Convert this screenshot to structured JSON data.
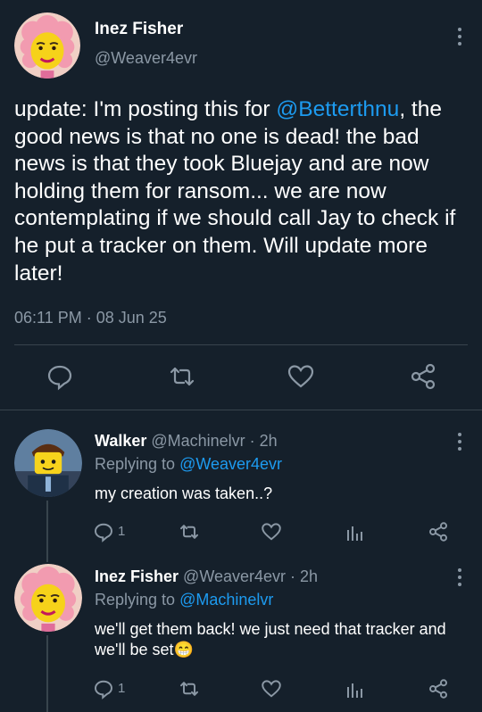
{
  "main_tweet": {
    "author_name": "Inez Fisher",
    "handle": "@Weaver4evr",
    "text_before": "update: I'm posting this for ",
    "mention": "@Betterthnu",
    "text_after": ", the good news is that no one is dead! the bad news is that they took Bluejay and are now holding them for ransom... we are now contemplating if we should call Jay to check if he put a tracker on them. Will update more later!",
    "timestamp": "06:11 PM · 08 Jun 25",
    "actions": [
      "comment-icon",
      "retweet-icon",
      "heart-icon",
      "share-icon"
    ]
  },
  "replies": [
    {
      "author_name": "Walker",
      "handle": "@Machinelvr · 2h",
      "replying_label": "Replying to ",
      "replying_to": "@Weaver4evr",
      "text": "my creation was taken..?",
      "comment_count": "1"
    },
    {
      "author_name": "Inez Fisher",
      "handle": "@Weaver4evr · 2h",
      "replying_label": "Replying to ",
      "replying_to": "@Machinelvr",
      "text": "we'll get them back! we just need that tracker and we'll be set",
      "emoji": "😁",
      "comment_count": "1"
    }
  ],
  "colors": {
    "background": "#15202b",
    "accent": "#1d9bf0",
    "muted": "#8b98a5",
    "divider": "#38444d"
  }
}
